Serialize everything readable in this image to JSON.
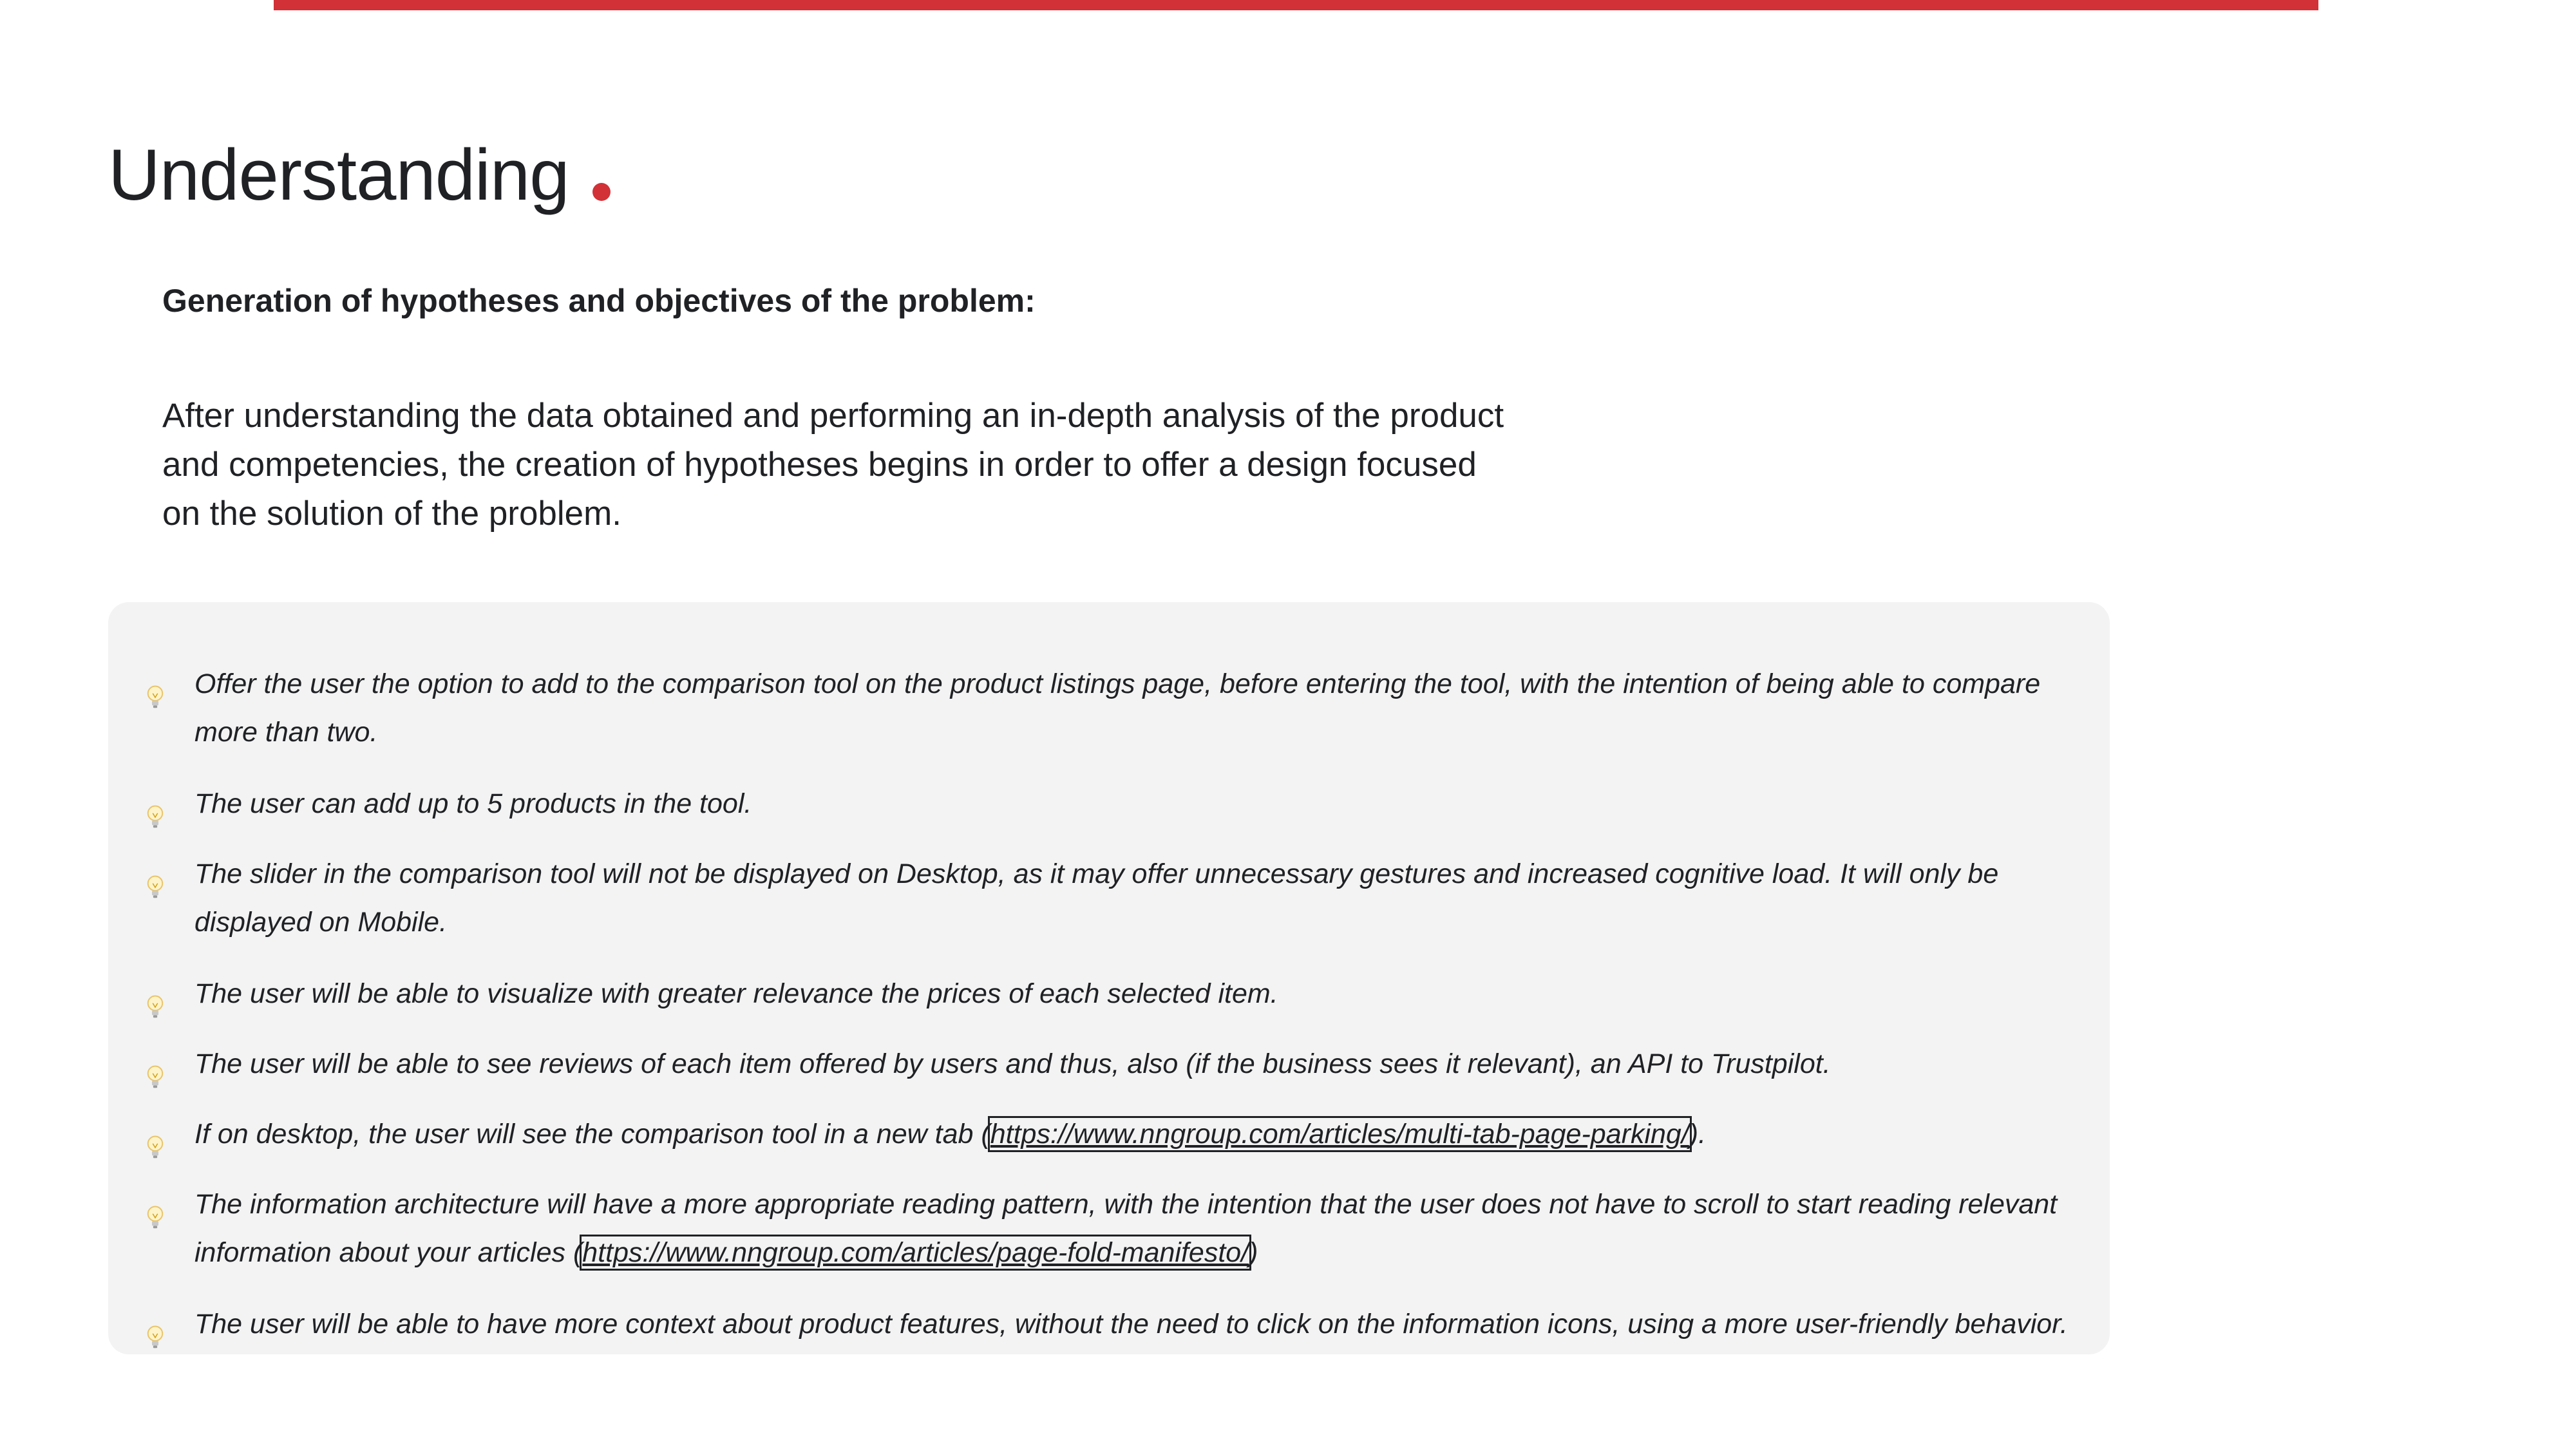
{
  "page": {
    "title": "Understanding",
    "accent_color": "#d23138"
  },
  "section": {
    "heading": "Generation of hypotheses and objectives of the problem:",
    "intro": "After understanding the data obtained and performing an in-depth analysis of the product and competencies, the creation of hypotheses begins in order to offer a design focused on the solution of the problem."
  },
  "hypotheses": {
    "icon": "lightbulb-icon",
    "items": [
      {
        "text": "Offer the user the option to add to the comparison tool on the product listings page, before entering the tool, with the intention of being able to compare more than two."
      },
      {
        "text": "The user can add up to 5 products in the tool."
      },
      {
        "text": "The slider in the comparison tool will not be displayed on Desktop, as it may offer unnecessary gestures and increased cognitive load. It will only be displayed on Mobile."
      },
      {
        "text": "The user will be able to visualize with greater relevance the prices of each selected item."
      },
      {
        "text": "The user will be able to see reviews of each item offered by users and thus, also (if the business sees it relevant), an API to Trustpilot."
      },
      {
        "text_before": "If on desktop, the user will see the comparison tool in a new tab (",
        "link": "https://www.nngroup.com/articles/multi-tab-page-parking/",
        "text_after": ")."
      },
      {
        "text_before": "The information architecture will have a more appropriate reading pattern, with the intention that the user does not have to scroll to start reading relevant information about your articles (",
        "link": "https://www.nngroup.com/articles/page-fold-manifesto/",
        "text_after": ")"
      },
      {
        "text": "The user will be able to have more context about product features, without the need to click on the information icons, using a more user-friendly behavior."
      }
    ]
  }
}
